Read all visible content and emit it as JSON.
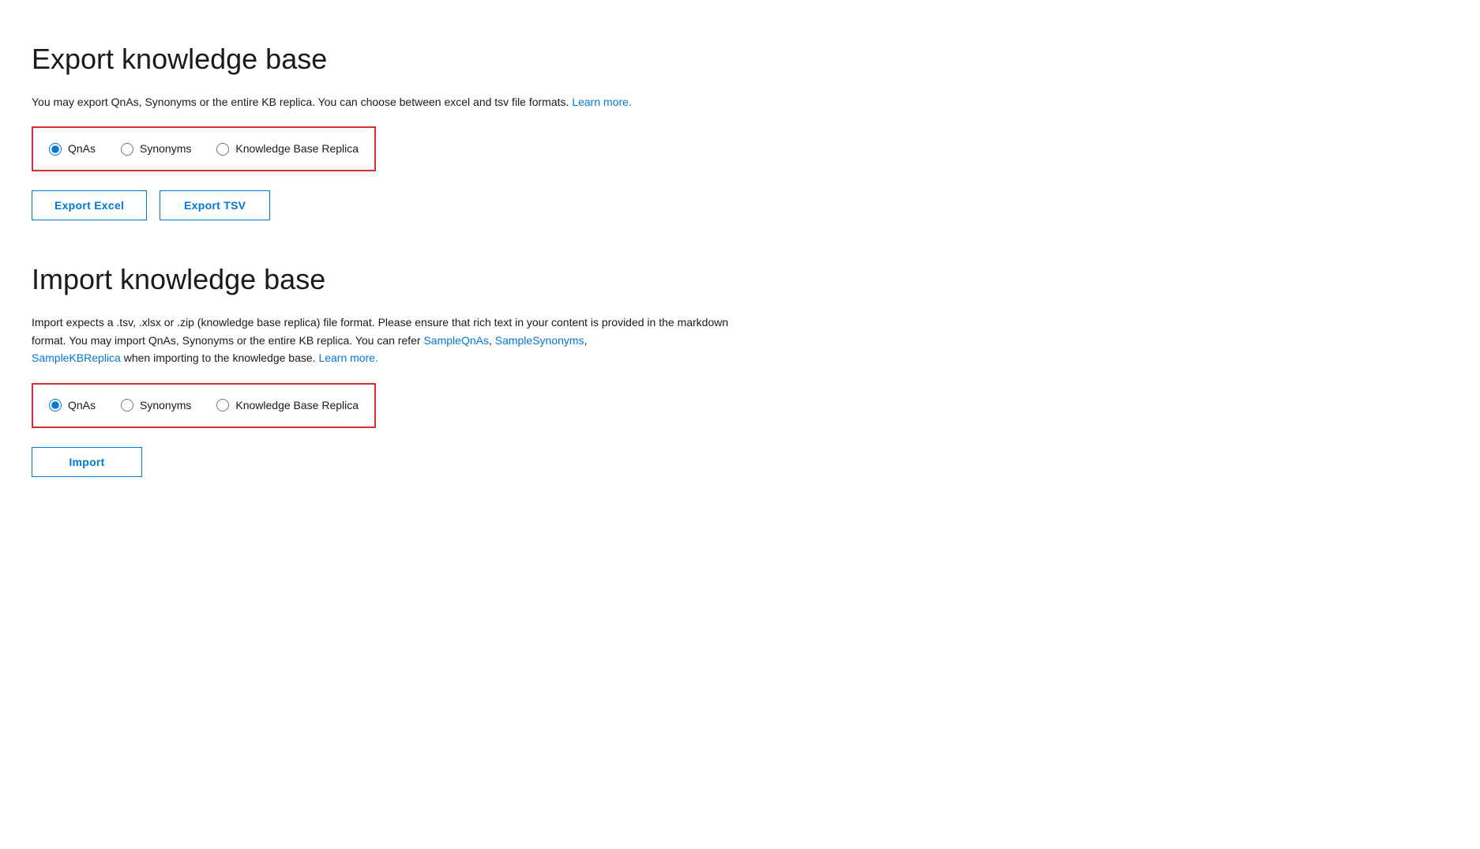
{
  "export": {
    "title": "Export knowledge base",
    "description_text": "You may export QnAs, Synonyms or the entire KB replica. You can choose between excel and tsv file formats.",
    "description_link_text": "Learn more.",
    "description_link_url": "#",
    "radio_group": {
      "options": [
        {
          "id": "export-qnas",
          "label": "QnAs",
          "checked": true
        },
        {
          "id": "export-synonyms",
          "label": "Synonyms",
          "checked": false
        },
        {
          "id": "export-kb-replica",
          "label": "Knowledge Base Replica",
          "checked": false
        }
      ]
    },
    "buttons": [
      {
        "id": "export-excel",
        "label": "Export Excel"
      },
      {
        "id": "export-tsv",
        "label": "Export TSV"
      }
    ]
  },
  "import": {
    "title": "Import knowledge base",
    "description_parts": [
      {
        "type": "text",
        "value": "Import expects a .tsv, .xlsx or .zip (knowledge base replica) file format. Please ensure that rich text in your content is provided in the markdown format. You may import QnAs, Synonyms or the entire KB replica. You can refer "
      },
      {
        "type": "link",
        "value": "SampleQnAs",
        "url": "#"
      },
      {
        "type": "text",
        "value": ", "
      },
      {
        "type": "link",
        "value": "SampleSynonyms",
        "url": "#"
      },
      {
        "type": "text",
        "value": ",\n"
      },
      {
        "type": "link",
        "value": "SampleKBReplica",
        "url": "#"
      },
      {
        "type": "text",
        "value": " when importing to the knowledge base. "
      },
      {
        "type": "link",
        "value": "Learn more.",
        "url": "#"
      }
    ],
    "radio_group": {
      "options": [
        {
          "id": "import-qnas",
          "label": "QnAs",
          "checked": true
        },
        {
          "id": "import-synonyms",
          "label": "Synonyms",
          "checked": false
        },
        {
          "id": "import-kb-replica",
          "label": "Knowledge Base Replica",
          "checked": false
        }
      ]
    },
    "buttons": [
      {
        "id": "import-btn",
        "label": "Import"
      }
    ]
  }
}
